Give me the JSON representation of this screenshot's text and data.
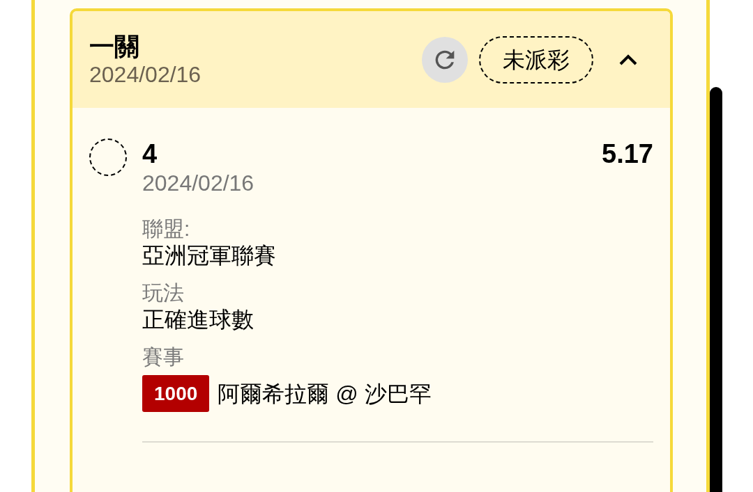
{
  "bet": {
    "title": "一關",
    "date": "2024/02/16",
    "status": "未派彩",
    "expanded": true,
    "legs": [
      {
        "selection": "4",
        "date": "2024/02/16",
        "odds": "5.17",
        "selected": false,
        "fields": [
          {
            "kind": "text",
            "label": "聯盟:",
            "value": "亞洲冠軍聯賽"
          },
          {
            "kind": "text",
            "label": "玩法",
            "value": "正確進球數"
          },
          {
            "kind": "match",
            "label": "賽事",
            "match_no": "1000",
            "value": "阿爾希拉爾 @ 沙巴罕"
          }
        ]
      }
    ]
  }
}
